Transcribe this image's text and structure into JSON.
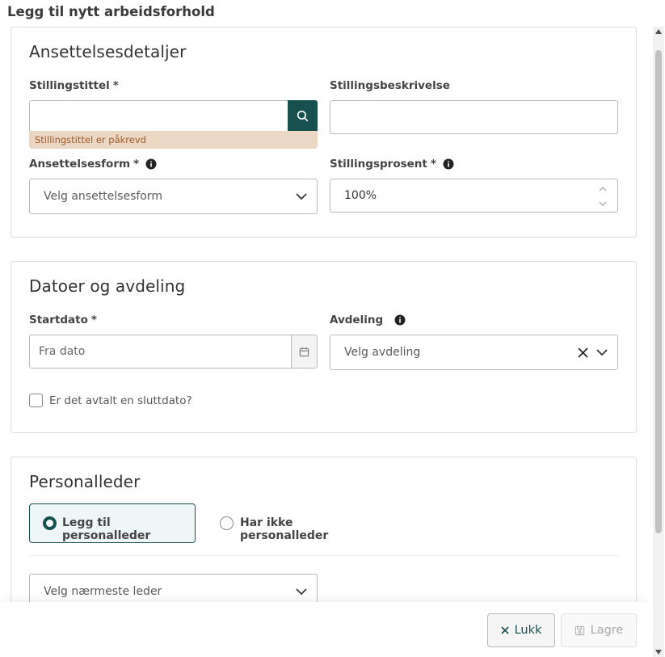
{
  "modal": {
    "title": "Legg til nytt arbeidsforhold"
  },
  "section1": {
    "title": "Ansettelsesdetaljer",
    "job_title": {
      "label": "Stillingstittel",
      "required": "*",
      "value": "",
      "error": "Stillingstittel er påkrevd"
    },
    "job_description": {
      "label": "Stillingsbeskrivelse",
      "value": ""
    },
    "employment_type": {
      "label": "Ansettelsesform",
      "required": "*",
      "placeholder": "Velg ansettelsesform"
    },
    "position_percent": {
      "label": "Stillingsprosent",
      "required": "*",
      "value": "100%"
    }
  },
  "section2": {
    "title": "Datoer og avdeling",
    "start_date": {
      "label": "Startdato",
      "required": "*",
      "placeholder": "Fra dato"
    },
    "department": {
      "label": "Avdeling",
      "placeholder": "Velg avdeling"
    },
    "end_date_checkbox": {
      "label": "Er det avtalt en sluttdato?",
      "checked": false
    }
  },
  "section3": {
    "title": "Personalleder",
    "options": [
      {
        "label": "Legg til personalleder",
        "selected": true
      },
      {
        "label": "Har ikke personalleder",
        "selected": false
      }
    ],
    "manager_select": {
      "placeholder": "Velg nærmeste leder"
    }
  },
  "footer": {
    "close_label": "Lukk",
    "save_label": "Lagre"
  },
  "colors": {
    "accent": "#17504f",
    "error_bg": "#ecd6c4",
    "error_text": "#9a5a2a"
  }
}
